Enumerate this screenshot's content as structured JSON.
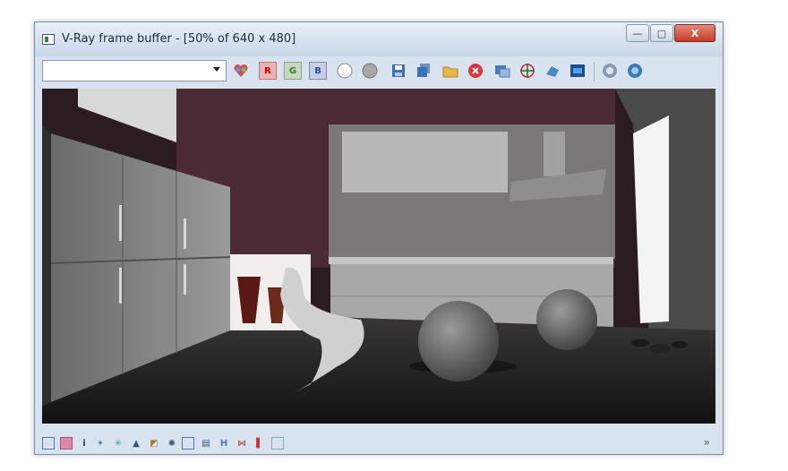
{
  "window": {
    "title": "V-Ray frame buffer - [50% of 640 x 480]",
    "close_label": "X",
    "minimize_label": "—",
    "maximize_label": "▢"
  },
  "toolbar": {
    "channel_select": "",
    "red_label": "R",
    "green_label": "G",
    "blue_label": "B"
  },
  "statusbar": {
    "info_label": "i",
    "hist_label": "H",
    "expand_label": "»"
  },
  "colors": {
    "window_bg": "#d9e3ef",
    "close_button": "#c33b25",
    "wall_accent": "#4a2a33"
  },
  "icons": [
    "color-corrections-icon",
    "red-channel-icon",
    "green-channel-icon",
    "blue-channel-icon",
    "alpha-channel-icon",
    "monochrome-icon",
    "save-image-icon",
    "save-all-icon",
    "load-image-icon",
    "clear-image-icon",
    "duplicate-icon",
    "track-mouse-icon",
    "region-render-icon",
    "render-last-icon",
    "vfb-history-icon",
    "lens-effects-icon"
  ]
}
